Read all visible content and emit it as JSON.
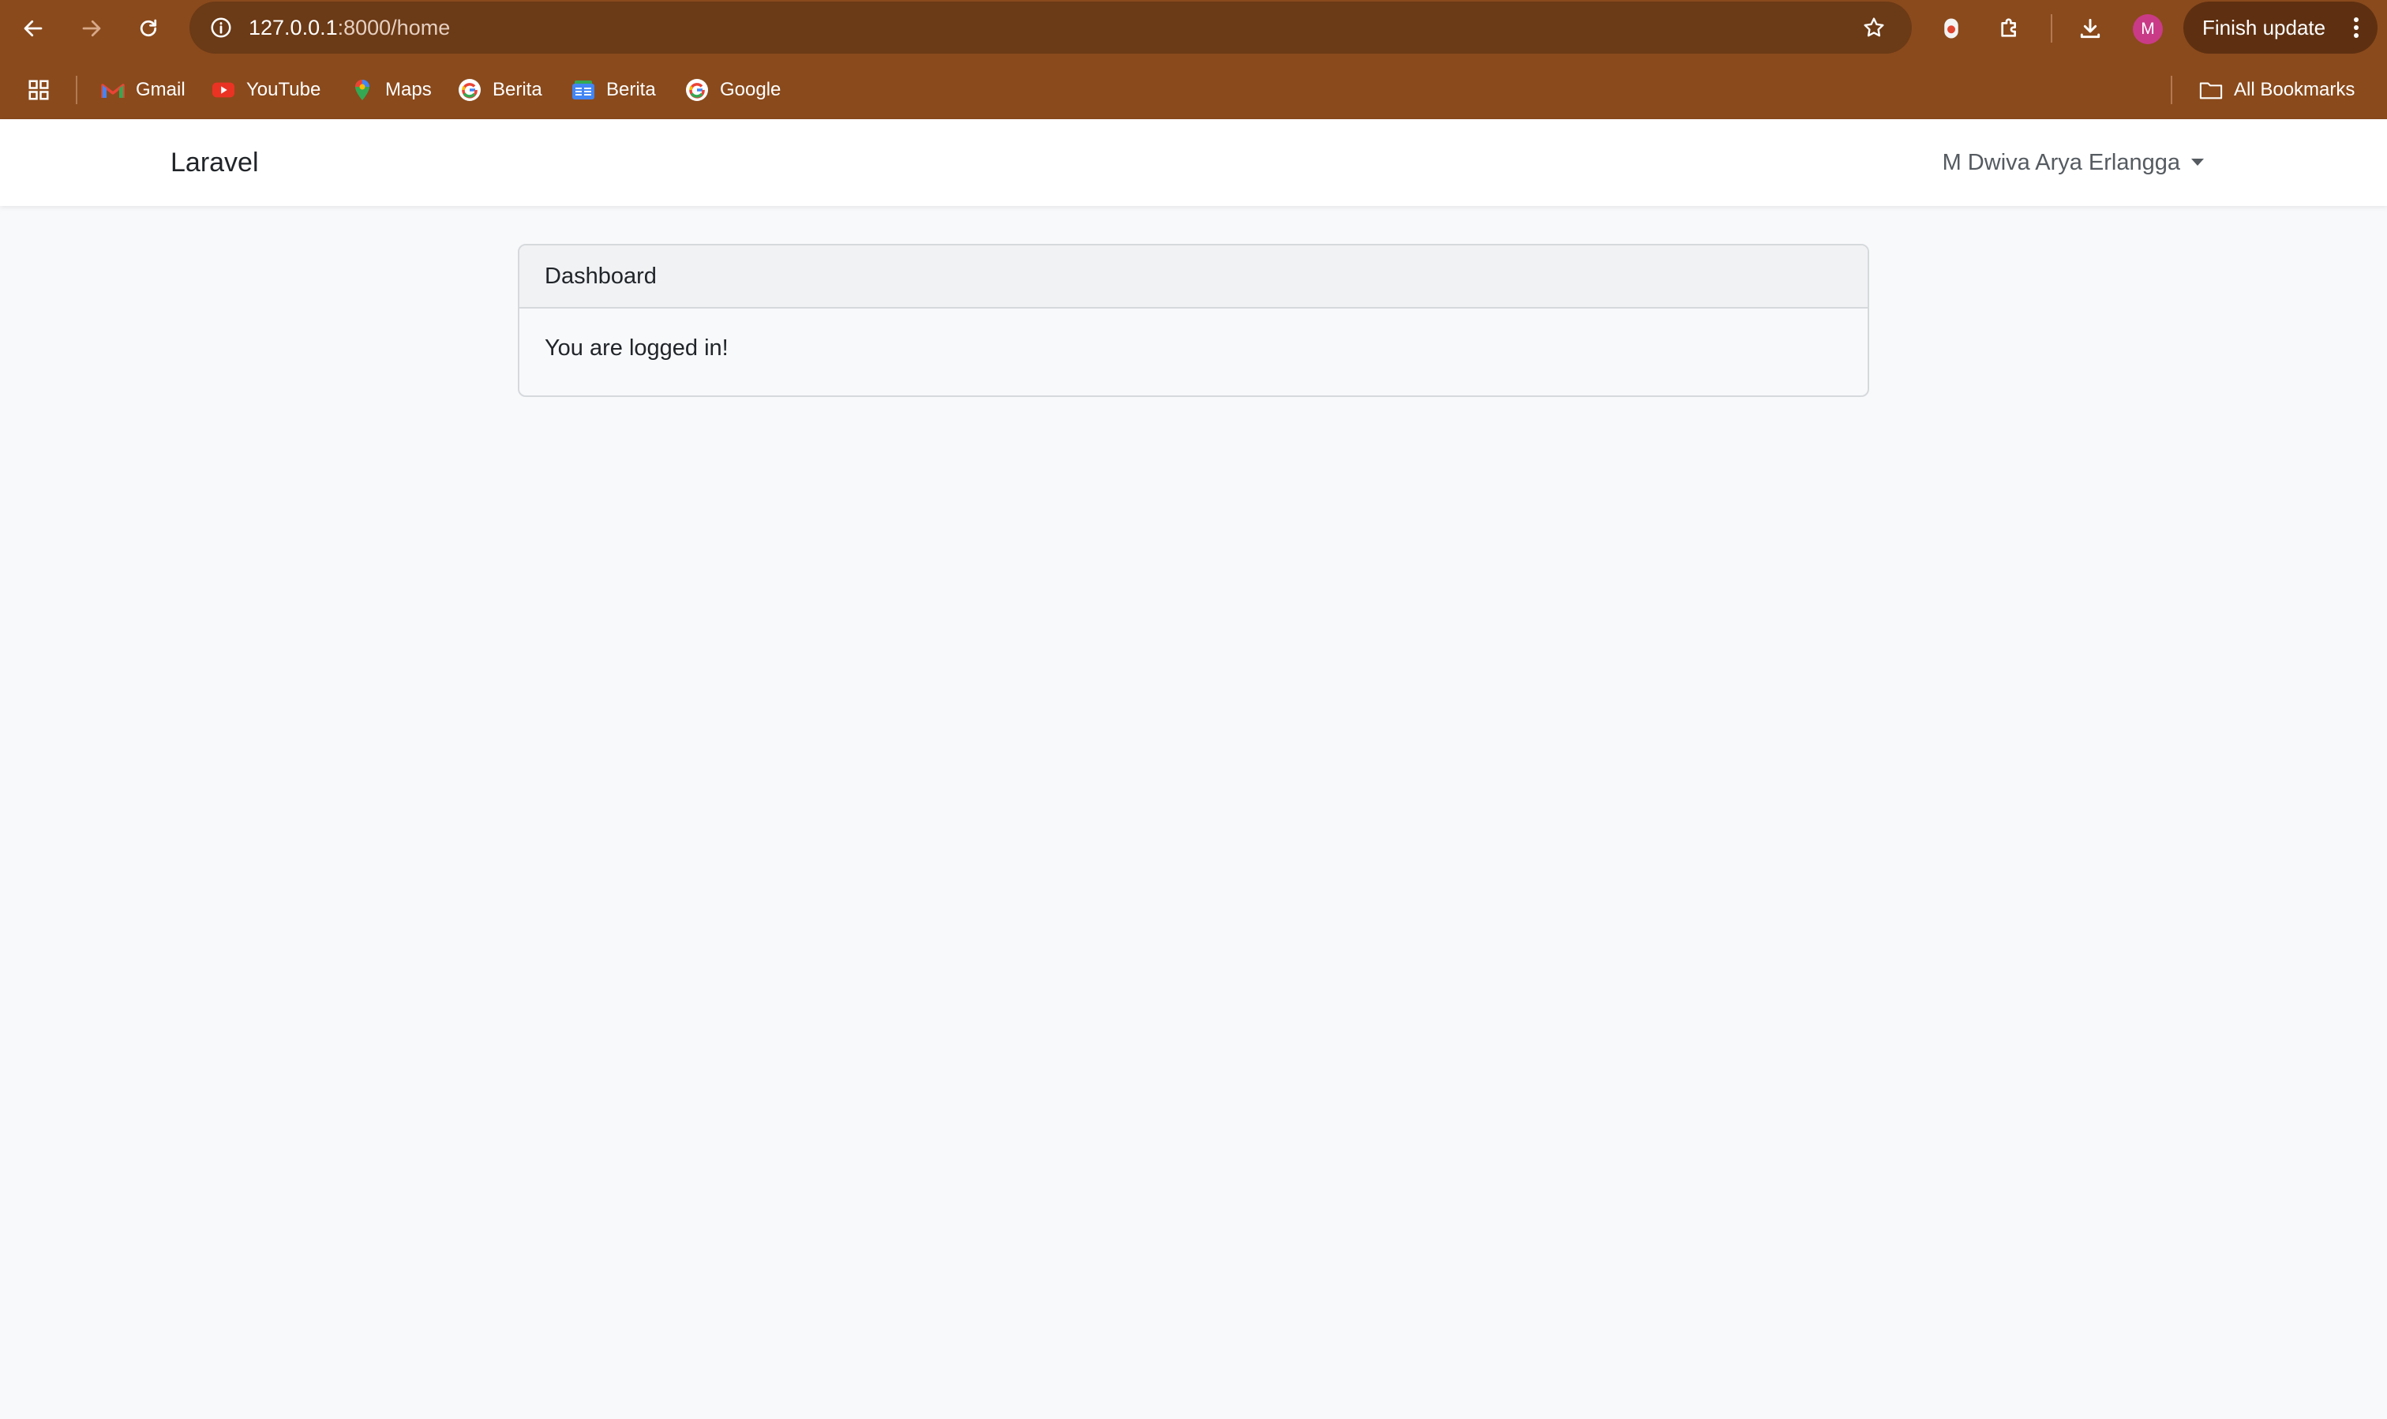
{
  "browser": {
    "address_bar": {
      "url_host": "127.0.0.1",
      "url_path": ":8000/home"
    },
    "profile_initial": "M",
    "finish_update_label": "Finish update",
    "bookmarks": [
      {
        "label": "Gmail",
        "icon": "gmail-icon"
      },
      {
        "label": "YouTube",
        "icon": "youtube-icon"
      },
      {
        "label": "Maps",
        "icon": "maps-icon"
      },
      {
        "label": "Berita",
        "icon": "google-icon"
      },
      {
        "label": "Berita",
        "icon": "google-news-icon"
      },
      {
        "label": "Google",
        "icon": "google-icon"
      }
    ],
    "all_bookmarks_label": "All Bookmarks",
    "colors": {
      "chrome_bg": "#8a4a1c",
      "omnibox_bg": "#6b3a16",
      "avatar_bg": "#c93b86"
    }
  },
  "navbar": {
    "brand": "Laravel",
    "user_name": "M Dwiva Arya Erlangga"
  },
  "card": {
    "header": "Dashboard",
    "body": "You are logged in!"
  }
}
